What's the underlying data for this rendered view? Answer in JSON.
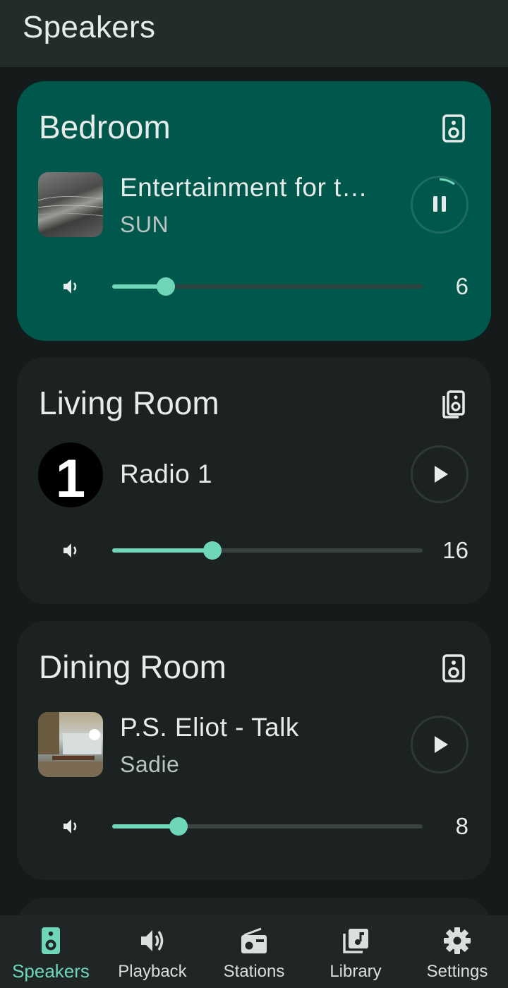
{
  "app": {
    "title": "Speakers"
  },
  "colors": {
    "accent": "#6fd7b7",
    "active_card": "#00574b",
    "card": "#1c2221",
    "background": "#141b1a"
  },
  "speakers": [
    {
      "room": "Bedroom",
      "title": "Entertainment for t…",
      "subtitle": "SUN",
      "state": "playing",
      "volume": "6",
      "volume_fraction": 0.17,
      "icon": "speaker-icon"
    },
    {
      "room": "Living Room",
      "title": "Radio 1",
      "subtitle": "",
      "station_logo": "1",
      "state": "paused",
      "volume": "16",
      "volume_fraction": 0.32,
      "icon": "speaker-group-icon"
    },
    {
      "room": "Dining Room",
      "title": "P.S. Eliot - Talk",
      "subtitle": "Sadie",
      "state": "paused",
      "volume": "8",
      "volume_fraction": 0.21,
      "icon": "speaker-icon"
    }
  ],
  "nav": [
    {
      "label": "Speakers",
      "icon": "speaker-icon",
      "selected": true
    },
    {
      "label": "Playback",
      "icon": "volume-icon"
    },
    {
      "label": "Stations",
      "icon": "radio-icon"
    },
    {
      "label": "Library",
      "icon": "library-icon"
    },
    {
      "label": "Settings",
      "icon": "gear-icon"
    }
  ]
}
